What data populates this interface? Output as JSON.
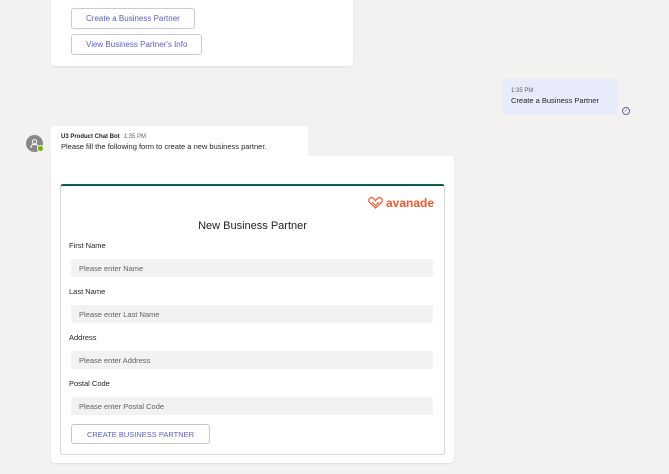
{
  "previous_card": {
    "buttons": [
      {
        "label": "Create a Business Partner"
      },
      {
        "label": "View Business Partner's Info"
      }
    ]
  },
  "user_message": {
    "time": "1:35 PM",
    "text": "Create a Business Partner",
    "status_icon": "read-receipt-icon"
  },
  "bot_message": {
    "sender": "U3 Product Chat Bot",
    "time": "1:35 PM",
    "text": "Please fill the following form to create a new business partner."
  },
  "form": {
    "brand": "avanade",
    "title": "New Business Partner",
    "fields": [
      {
        "label": "First Name",
        "placeholder": "Please enter Name",
        "value": ""
      },
      {
        "label": "Last Name",
        "placeholder": "Please enter Last Name",
        "value": ""
      },
      {
        "label": "Address",
        "placeholder": "Please enter Address",
        "value": ""
      },
      {
        "label": "Postal Code",
        "placeholder": "Please enter Postal Code",
        "value": ""
      }
    ],
    "submit_label": "CREATE BUSINESS PARTNER"
  },
  "colors": {
    "accent": "#5b5fc7",
    "brand": "#f05a2c",
    "card_top_border": "#0b5c56",
    "presence": "#6bb700",
    "my_bubble": "#e8ebfa"
  }
}
